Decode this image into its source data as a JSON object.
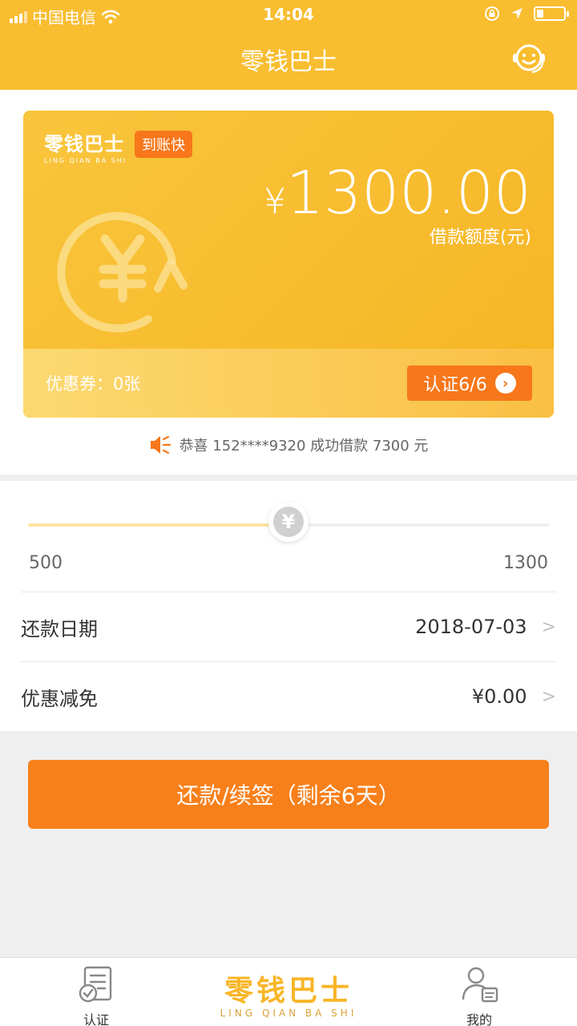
{
  "status_bar": {
    "carrier": "中国电信",
    "time": "14:04"
  },
  "nav": {
    "title": "零钱巴士",
    "support_icon": "customer-service-icon"
  },
  "card": {
    "brand_cn": "零钱巴士",
    "brand_en": "LING QIAN BA SHI",
    "badge": "到账快",
    "currency_symbol": "¥",
    "amount": "1300.00",
    "amount_label": "借款额度(元)",
    "coupon_label": "优惠券：",
    "coupon_value": "0张",
    "verify_label": "认证6/6",
    "accent": "#f7771a",
    "primary": "#f9bd30"
  },
  "ticker": {
    "text": "恭喜 152****9320 成功借款 7300 元",
    "icon": "speaker-icon"
  },
  "slider": {
    "min_label": "500",
    "max_label": "1300",
    "min": 500,
    "max": 1300,
    "value": 900
  },
  "rows": [
    {
      "label": "还款日期",
      "value": "2018-07-03"
    },
    {
      "label": "优惠减免",
      "value": "¥0.00"
    }
  ],
  "main_button": {
    "label": "还款/续签（剩余6天）"
  },
  "tabbar": {
    "left": {
      "label": "认证",
      "icon": "verify-document-icon"
    },
    "center": {
      "cn": "零钱巴士",
      "en": "LING QIAN BA SHI"
    },
    "right": {
      "label": "我的",
      "icon": "profile-icon"
    }
  }
}
